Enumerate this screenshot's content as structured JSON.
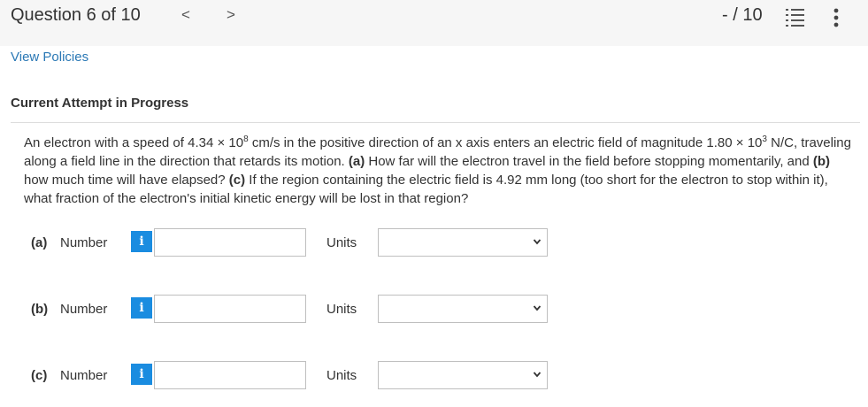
{
  "header": {
    "question_label": "Question 6 of 10",
    "prev": "<",
    "next": ">",
    "score": "- / 10"
  },
  "links": {
    "view_policies": "View Policies"
  },
  "attempt": {
    "title": "Current Attempt in Progress"
  },
  "question": {
    "t1": "An electron with a speed of 4.34 × 10",
    "e1": "8",
    "t2": " cm/s in the positive direction of an x axis enters an electric field of magnitude 1.80 × 10",
    "e2": "3",
    "t3": " N/C, traveling along a field line in the direction that retards its motion. ",
    "a": "(a)",
    "t4": " How far will the electron travel in the field before stopping momentarily, and ",
    "b": "(b)",
    "t5": " how much time will have elapsed? ",
    "c": "(c)",
    "t6": " If the region containing the electric field is 4.92 mm long (too short for the electron to stop within it), what fraction of the electron's initial kinetic energy will be lost in that region?"
  },
  "parts": [
    {
      "part": "(a)",
      "number_label": "Number",
      "info": "i",
      "value": "",
      "units_label": "Units",
      "units_value": ""
    },
    {
      "part": "(b)",
      "number_label": "Number",
      "info": "i",
      "value": "",
      "units_label": "Units",
      "units_value": ""
    },
    {
      "part": "(c)",
      "number_label": "Number",
      "info": "i",
      "value": "",
      "units_label": "Units",
      "units_value": ""
    }
  ],
  "colors": {
    "link": "#2a78b5",
    "info_button": "#1a8ce0",
    "page_bg": "#f6f6f6"
  },
  "icons": {
    "list": "list-icon",
    "more": "more-vertical-icon",
    "chevron": "chevron-down-icon"
  }
}
